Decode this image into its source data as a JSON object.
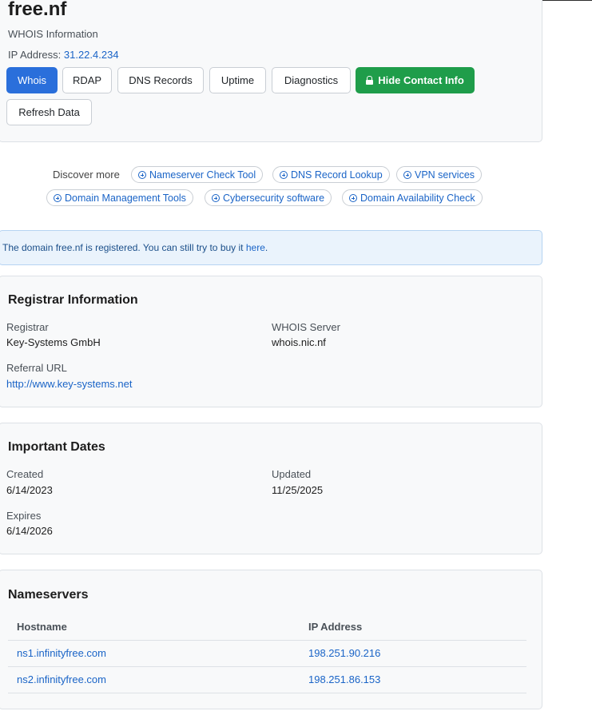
{
  "header": {
    "domain": "free.nf",
    "subtitle": "WHOIS Information",
    "ip_label": "IP Address:",
    "ip_value": "31.22.4.234"
  },
  "tabs": {
    "whois": "Whois",
    "rdap": "RDAP",
    "dns": "DNS Records",
    "uptime": "Uptime",
    "diagnostics": "Diagnostics",
    "hide_contact": "Hide Contact Info",
    "refresh": "Refresh Data"
  },
  "discover": {
    "label": "Discover more",
    "items": [
      "Nameserver Check Tool",
      "DNS Record Lookup",
      "VPN services",
      "Domain Management Tools",
      "Cybersecurity software",
      "Domain Availability Check"
    ]
  },
  "alert": {
    "prefix": "The domain ",
    "domain": "free.nf",
    "middle": " is registered. You can still try to buy it ",
    "link": "here",
    "suffix": "."
  },
  "registrar": {
    "title": "Registrar Information",
    "registrar_label": "Registrar",
    "registrar_value": "Key-Systems GmbH",
    "whois_label": "WHOIS Server",
    "whois_value": "whois.nic.nf",
    "referral_label": "Referral URL",
    "referral_value": "http://www.key-systems.net"
  },
  "dates": {
    "title": "Important Dates",
    "created_label": "Created",
    "created_value": "6/14/2023",
    "updated_label": "Updated",
    "updated_value": "11/25/2025",
    "expires_label": "Expires",
    "expires_value": "6/14/2026"
  },
  "nameservers": {
    "title": "Nameservers",
    "col_host": "Hostname",
    "col_ip": "IP Address",
    "rows": [
      {
        "host": "ns1.infinityfree.com",
        "ip": "198.251.90.216"
      },
      {
        "host": "ns2.infinityfree.com",
        "ip": "198.251.86.153"
      }
    ]
  },
  "colors": {
    "primary": "#2a6fdb",
    "success": "#1f9d4a",
    "link": "#1a64c7",
    "card_bg": "#f8f9fa",
    "alert_bg": "#eaf3fc"
  }
}
